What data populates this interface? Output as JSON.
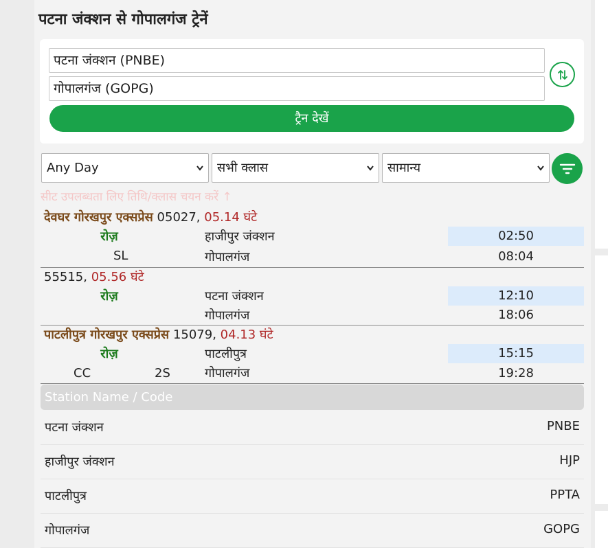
{
  "page": {
    "title": "पटना जंक्शन से गोपालगंज ट्रेनें"
  },
  "search": {
    "from_value": "पटना जंक्शन (PNBE)",
    "to_value": "गोपालगंज (GOPG)",
    "swap_icon": "swap-vertical-icon",
    "button_label": "ट्रैन देखें"
  },
  "filters": {
    "day": "Any Day",
    "class": "सभी क्लास",
    "quota": "सामान्य",
    "filter_icon": "filter-icon",
    "hint": "सीट उपलब्धता लिए तिथि/क्लास चयन करें ↑"
  },
  "trains": [
    {
      "name": "देवघर गोरखपुर एक्सप्रेस",
      "number": "05027,",
      "duration": "05.14 घंटे",
      "runs": "रोज़",
      "classes": [
        "SL"
      ],
      "from_station": "हाजीपुर जंक्शन",
      "dep_time": "02:50",
      "to_station": "गोपालगंज",
      "arr_time": "08:04"
    },
    {
      "name": "",
      "number": "55515,",
      "duration": "05.56 घंटे",
      "runs": "रोज़",
      "classes": [],
      "from_station": "पटना जंक्शन",
      "dep_time": "12:10",
      "to_station": "गोपालगंज",
      "arr_time": "18:06"
    },
    {
      "name": "पाटलीपुत्र गोरखपुर एक्सप्रेस",
      "number": "15079,",
      "duration": "04.13 घंटे",
      "runs": "रोज़",
      "classes": [
        "CC",
        "2S"
      ],
      "from_station": "पाटलीपुत्र",
      "dep_time": "15:15",
      "to_station": "गोपालगंज",
      "arr_time": "19:28"
    }
  ],
  "stations_table": {
    "header": "Station Name / Code",
    "rows": [
      {
        "name": "पटना जंक्शन",
        "code": "PNBE"
      },
      {
        "name": "हाजीपुर जंक्शन",
        "code": "HJP"
      },
      {
        "name": "पाटलीपुत्र",
        "code": "PPTA"
      },
      {
        "name": "गोपालगंज",
        "code": "GOPG"
      }
    ]
  },
  "colors": {
    "accent_green": "#1aa34a",
    "train_name": "#7a4a1a",
    "duration": "#b02828",
    "runs": "#1b7a1b",
    "time_highlight": "#dcebfb"
  }
}
